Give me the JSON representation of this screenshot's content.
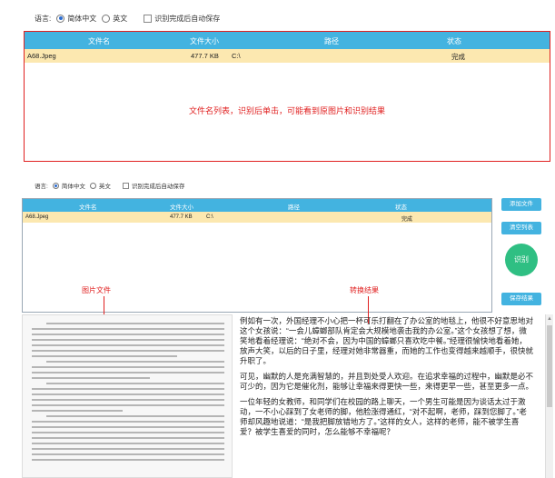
{
  "top": {
    "language_label": "语言:",
    "lang_options": [
      "简体中文",
      "英文"
    ],
    "autosave_label": "识别完成后自动保存",
    "columns": [
      "文件名",
      "文件大小",
      "路径",
      "状态"
    ],
    "row": {
      "name": "A68.Jpeg",
      "size": "477.7 KB",
      "path": "C:\\",
      "status": "完成"
    },
    "annotation": "文件名列表，识别后单击，可能看到原图片和识别结果"
  },
  "bottom": {
    "language_label": "语言:",
    "lang_options": [
      "简体中文",
      "英文"
    ],
    "autosave_label": "识别完成后自动保存",
    "columns": [
      "文件名",
      "文件大小",
      "路径",
      "状态"
    ],
    "row": {
      "name": "A68.Jpeg",
      "size": "477.7 KB",
      "path": "C:\\",
      "status": "完成"
    },
    "buttons": {
      "add": "添加文件",
      "clear": "清空列表",
      "recognize": "识别",
      "save": "保存结果"
    },
    "label_image": "图片文件",
    "label_result": "转换结果",
    "result_paragraphs": [
      "例如有一次，外国经理不小心把一杯可乐打翻在了办公室的地毯上，他很不好意思地对这个女孩说：“一会儿蟑螂部队肯定会大规模地袭击我的办公室。”这个女孩想了想，微笑地看着经理说：“绝对不会，因为中国的蟑螂只喜欢吃中餐。”经理很愉快地看着她，放声大笑，以后的日子里，经理对她非常器重，而她的工作也变得越来越顺手，很快就升职了。",
      "可见，幽默的人是充满智慧的，并且到处受人欢迎。在追求幸福的过程中，幽默是必不可少的，因为它是催化剂，能够让幸福来得更快一些，来得更早一些，甚至更多一点。",
      "一位年轻的女教师，和同学们在校园的路上聊天，一个男生可能是因为谈话太过于激动，一不小心踩到了女老师的脚，他脸涨得通红，“对不起啊，老师，踩到您脚了。”老师却风趣地说道：“是我把脚放错地方了。”这样的女人，这样的老师，能不被学生喜爱？被学生喜爱的同时，怎么能够不幸福呢？"
    ]
  },
  "colors": {
    "header": "#43b3e0",
    "row_done": "#fce8b0",
    "annotation": "#e02020",
    "recognize": "#2fbf83"
  }
}
